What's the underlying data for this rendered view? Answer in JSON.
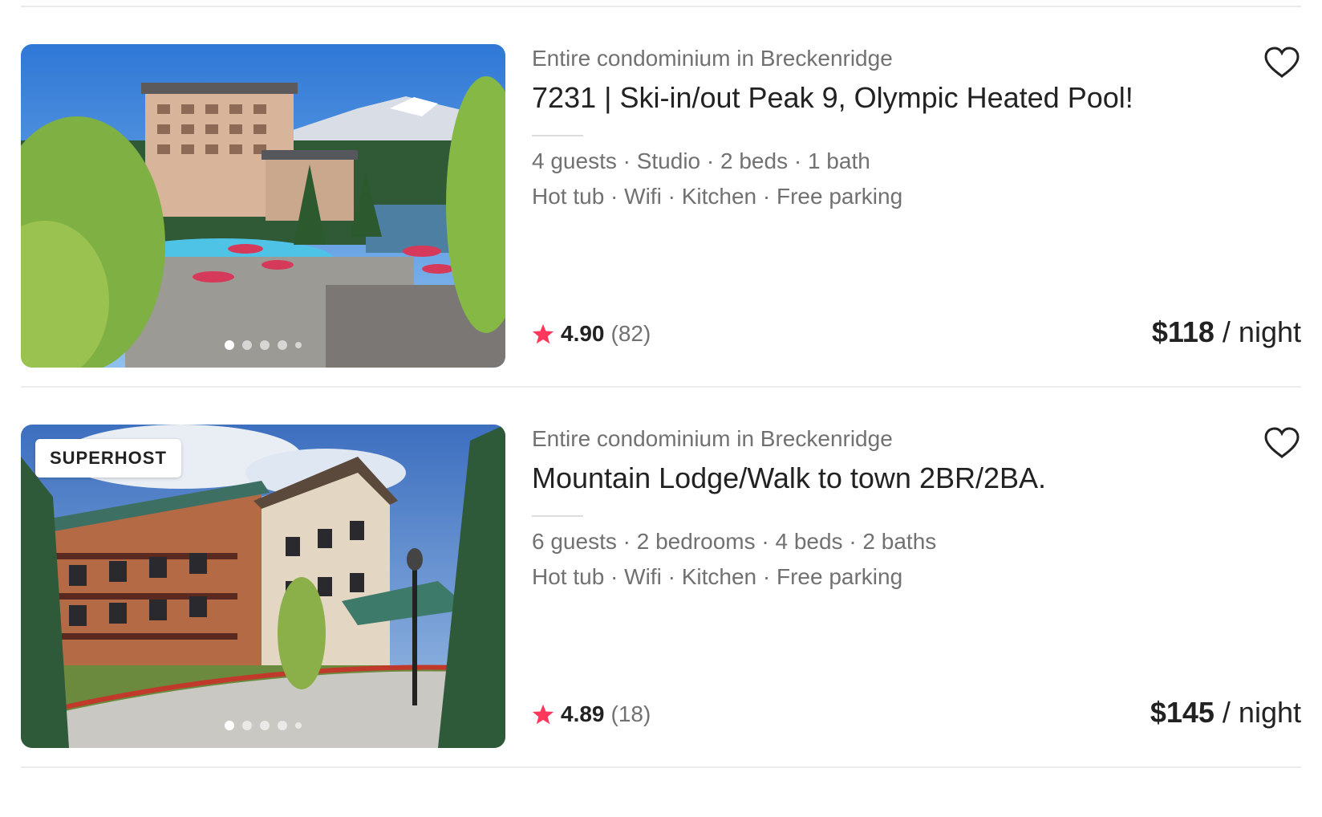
{
  "listings": [
    {
      "subtitle": "Entire condominium in Breckenridge",
      "title": "7231 | Ski-in/out Peak 9, Olympic Heated Pool!",
      "details": "4 guests · Studio · 2 beds · 1 bath",
      "amenities": "Hot tub · Wifi · Kitchen · Free parking",
      "rating": "4.90",
      "reviews": "(82)",
      "price": "$118",
      "price_unit": " / night",
      "badge": "",
      "photo_index": 1,
      "photo_count": 5
    },
    {
      "subtitle": "Entire condominium in Breckenridge",
      "title": "Mountain Lodge/Walk to town 2BR/2BA.",
      "details": "6 guests · 2 bedrooms · 4 beds · 2 baths",
      "amenities": "Hot tub · Wifi · Kitchen · Free parking",
      "rating": "4.89",
      "reviews": "(18)",
      "price": "$145",
      "price_unit": " / night",
      "badge": "SUPERHOST",
      "photo_index": 1,
      "photo_count": 5
    }
  ],
  "icons": {
    "favorite": "heart-icon",
    "rating": "star-icon"
  },
  "colors": {
    "star": "#ff385c",
    "text": "#222222",
    "muted": "#717171"
  }
}
